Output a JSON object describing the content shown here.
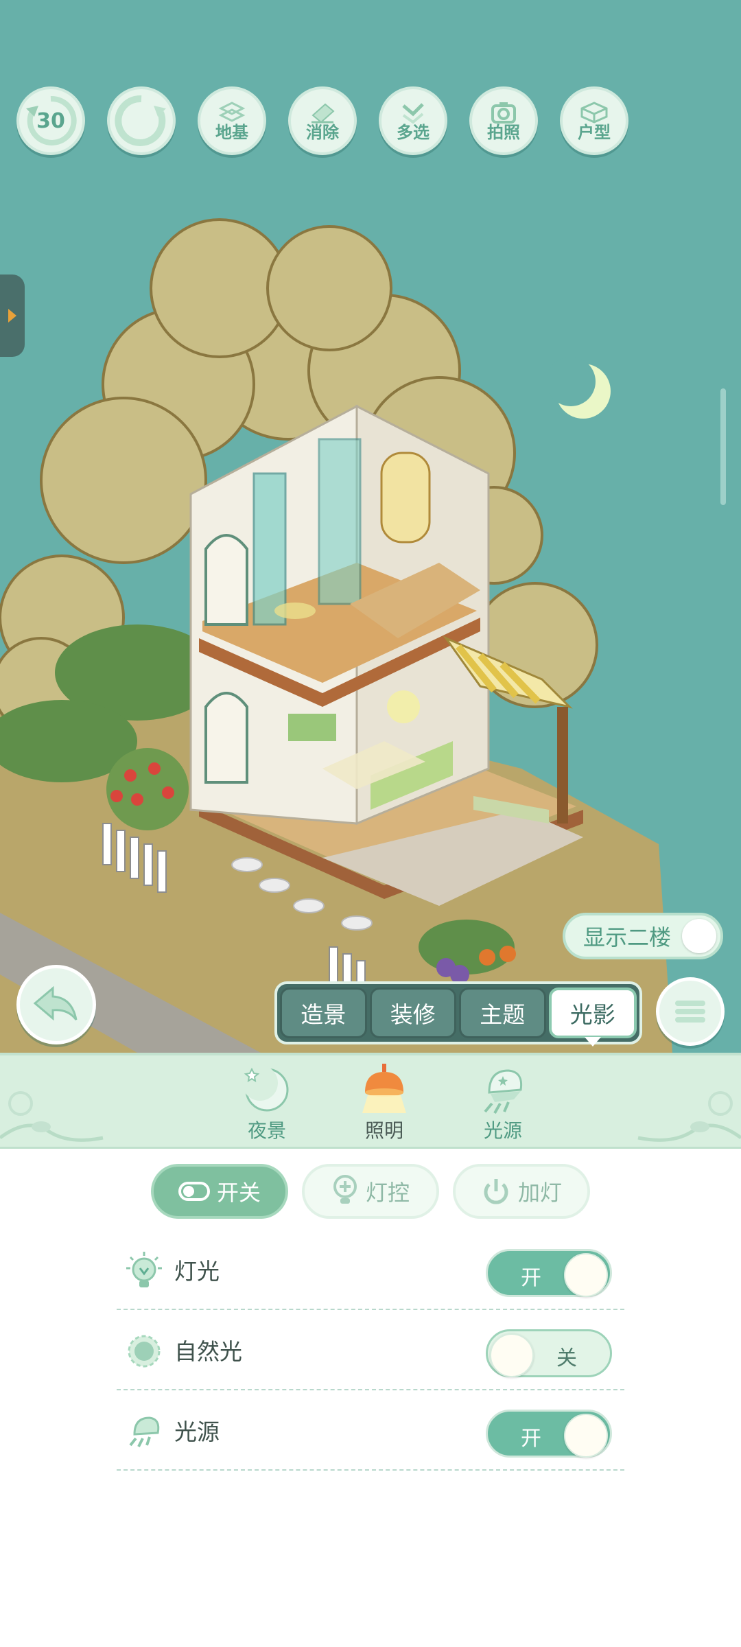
{
  "toolbar": {
    "undo_count": "30",
    "foundation_label": "地基",
    "erase_label": "消除",
    "multiselect_label": "多选",
    "photo_label": "拍照",
    "floorplan_label": "户型"
  },
  "scene": {
    "show_second_floor_label": "显示二楼",
    "show_second_floor_on": false
  },
  "mode_tabs": [
    {
      "label": "造景",
      "active": false
    },
    {
      "label": "装修",
      "active": false
    },
    {
      "label": "主题",
      "active": false
    },
    {
      "label": "光影",
      "active": true
    }
  ],
  "subnav": [
    {
      "label": "夜景",
      "icon": "moon-icon",
      "active": false
    },
    {
      "label": "照明",
      "icon": "lamp-icon",
      "active": true
    },
    {
      "label": "光源",
      "icon": "light-source-icon",
      "active": false
    }
  ],
  "control_tabs": [
    {
      "label": "开关",
      "icon": "toggle-icon",
      "active": true
    },
    {
      "label": "灯控",
      "icon": "bulb-icon",
      "active": false
    },
    {
      "label": "加灯",
      "icon": "power-icon",
      "active": false
    }
  ],
  "settings": [
    {
      "label": "灯光",
      "state_text": "开",
      "on": true,
      "icon": "bulb-icon"
    },
    {
      "label": "自然光",
      "state_text": "关",
      "on": false,
      "icon": "sun-icon"
    },
    {
      "label": "光源",
      "state_text": "开",
      "on": true,
      "icon": "light-source-icon"
    }
  ],
  "colors": {
    "sky": "#67b0a9",
    "accent_green": "#6cbca3",
    "panel_mint": "#d8efdf",
    "tab_dark": "#456d66"
  }
}
